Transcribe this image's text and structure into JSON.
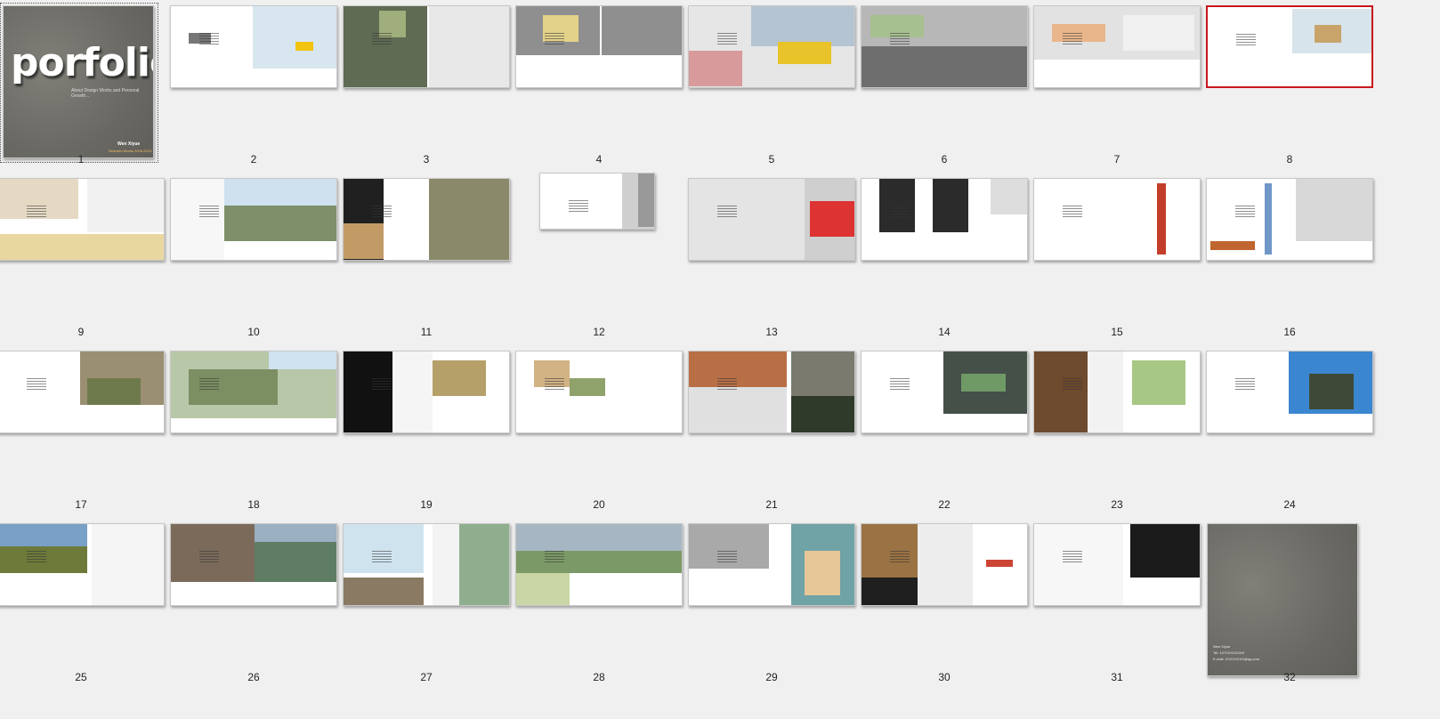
{
  "pages": [
    {
      "num": "1"
    },
    {
      "num": "2"
    },
    {
      "num": "3"
    },
    {
      "num": "4"
    },
    {
      "num": "5"
    },
    {
      "num": "6"
    },
    {
      "num": "7"
    },
    {
      "num": "8"
    },
    {
      "num": "9"
    },
    {
      "num": "10"
    },
    {
      "num": "11"
    },
    {
      "num": "12"
    },
    {
      "num": "13"
    },
    {
      "num": "14"
    },
    {
      "num": "15"
    },
    {
      "num": "16"
    },
    {
      "num": "17"
    },
    {
      "num": "18"
    },
    {
      "num": "19"
    },
    {
      "num": "20"
    },
    {
      "num": "21"
    },
    {
      "num": "22"
    },
    {
      "num": "23"
    },
    {
      "num": "24"
    },
    {
      "num": "25"
    },
    {
      "num": "26"
    },
    {
      "num": "27"
    },
    {
      "num": "28"
    },
    {
      "num": "29"
    },
    {
      "num": "30"
    },
    {
      "num": "31"
    },
    {
      "num": "32"
    }
  ],
  "cover": {
    "title": "porfolio",
    "subtitle": "About Design Works and Personal Growth...",
    "author": "Wen Xiyue",
    "years": "Selected Works 2009-2013"
  },
  "back_cover": {
    "author": "Wen Xiyue",
    "tel": "Tel: 137XXXXXXXX",
    "email": "E-mail: XXXXXXXX@qq.com"
  },
  "selected_page": "8",
  "colors": {
    "selection": "#c8161d",
    "background": "#f0f0f0",
    "cover": "#6f6f6a"
  }
}
